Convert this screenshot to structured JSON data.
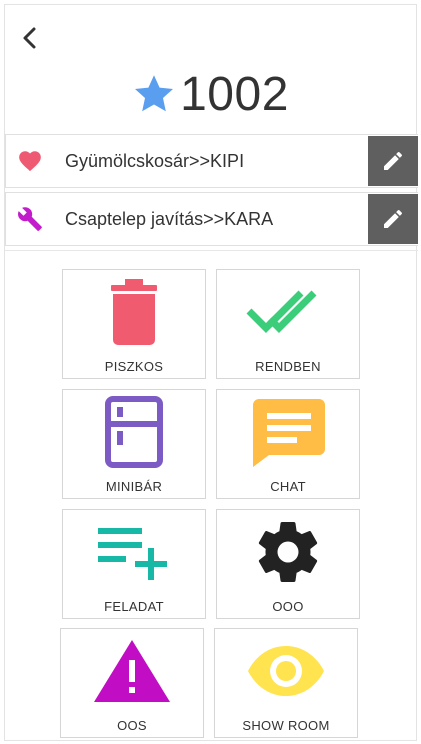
{
  "header": {
    "room_number": "1002"
  },
  "notes": [
    {
      "text": "Gyümölcskosár>>KIPI",
      "icon": "heart-icon",
      "color": "#ef5a73"
    },
    {
      "text": "Csaptelep javítás>>KARA",
      "icon": "wrench-icon",
      "color": "#c21ccd"
    }
  ],
  "tiles": [
    {
      "label": "PISZKOS",
      "icon": "trash-icon",
      "color": "#f05b6f"
    },
    {
      "label": "RENDBEN",
      "icon": "double-check-icon",
      "color": "#3ccd7a"
    },
    {
      "label": "MINIBÁR",
      "icon": "fridge-icon",
      "color": "#7c5cc4"
    },
    {
      "label": "CHAT",
      "icon": "chat-icon",
      "color": "#ffbd46"
    },
    {
      "label": "FELADAT",
      "icon": "playlist-add-icon",
      "color": "#17b8a6"
    },
    {
      "label": "OOO",
      "icon": "gear-icon",
      "color": "#222222"
    },
    {
      "label": "OOS",
      "icon": "warning-icon",
      "color": "#c10dc3"
    },
    {
      "label": "SHOW ROOM",
      "icon": "eye-icon",
      "color": "#ffe34f"
    }
  ],
  "colors": {
    "star": "#5a9ef0",
    "edit_button": "#5f5f5f"
  }
}
